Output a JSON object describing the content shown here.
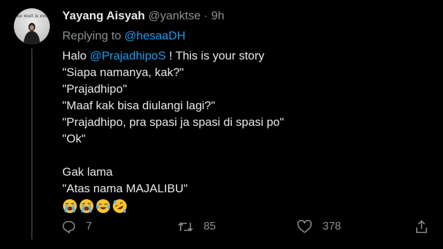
{
  "tweet": {
    "author_name": "Yayang Aisyah",
    "handle": "@yanktse",
    "separator": "·",
    "time": "9h",
    "avatar_text": "The wait is over",
    "replying_prefix": "Replying to",
    "replying_to": "@hesaaDH",
    "lines": [
      {
        "pre": "Halo ",
        "mention": "@PrajadhipoS",
        "post": " ! This is your story"
      },
      {
        "text": "\"Siapa namanya, kak?\""
      },
      {
        "text": "\"Prajadhipo\""
      },
      {
        "text": "\"Maaf kak bisa diulangi lagi?\""
      },
      {
        "text": "\"Prajadhipo, pra spasi ja spasi di spasi po\""
      },
      {
        "text": "\"Ok\""
      },
      {
        "text": "Gak lama"
      },
      {
        "text": "\"Atas nama MAJALIBU\""
      }
    ],
    "emojis": [
      "loudly-crying-face",
      "loudly-crying-face",
      "face-with-tears-of-joy",
      "rolling-on-the-floor-laughing"
    ]
  },
  "actions": {
    "reply_count": "7",
    "retweet_count": "85",
    "like_count": "378"
  },
  "colors": {
    "background": "#000000",
    "link": "#1d9bf0",
    "muted": "#8b8f93",
    "text": "#e7e9ea"
  }
}
